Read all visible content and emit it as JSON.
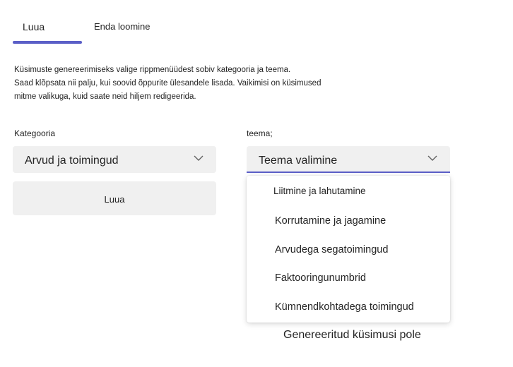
{
  "tabs": [
    {
      "label": "Luua",
      "active": true
    },
    {
      "label": "Enda loomine",
      "active": false
    }
  ],
  "instructions": [
    "Küsimuste genereerimiseks valige rippmenüüdest sobiv kategooria ja teema.",
    "Saad klõpsata nii palju, kui soovid õppurite ülesandele lisada. Vaikimisi on küsimused",
    "mitme valikuga, kuid saate neid hiljem redigeerida."
  ],
  "category": {
    "label": "Kategooria",
    "value": "Arvud ja toimingud"
  },
  "topic": {
    "label": "teema;",
    "value": "Teema valimine",
    "options": [
      "Liitmine ja lahutamine",
      "Korrutamine ja jagamine",
      "Arvudega segatoimingud",
      "Faktooringunumbrid",
      "Kümnendkohtadega toimingud"
    ]
  },
  "create_button": {
    "label": "Luua"
  },
  "empty_state": "Genereeritud küsimusi pole",
  "colors": {
    "accent": "#5b5fc7",
    "field_bg": "#f0f0f0",
    "text": "#242424"
  }
}
